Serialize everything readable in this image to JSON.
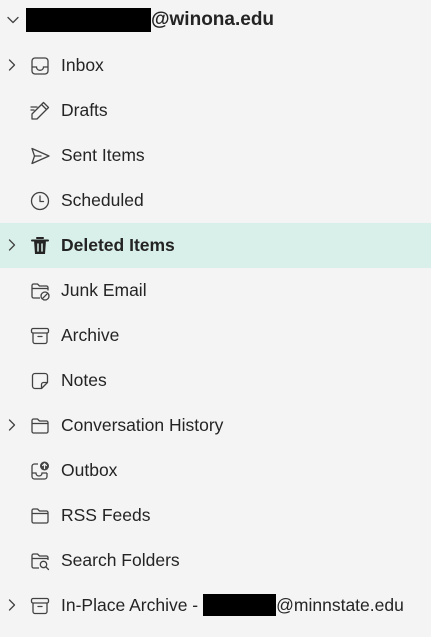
{
  "account": {
    "domain_label": "@winona.edu"
  },
  "folders": [
    {
      "label": "Inbox"
    },
    {
      "label": "Drafts"
    },
    {
      "label": "Sent Items"
    },
    {
      "label": "Scheduled"
    },
    {
      "label": "Deleted Items"
    },
    {
      "label": "Junk Email"
    },
    {
      "label": "Archive"
    },
    {
      "label": "Notes"
    },
    {
      "label": "Conversation History"
    },
    {
      "label": "Outbox"
    },
    {
      "label": "RSS Feeds"
    },
    {
      "label": "Search Folders"
    },
    {
      "label": "In-Place Archive -",
      "label_suffix": "@minnstate.edu"
    }
  ]
}
